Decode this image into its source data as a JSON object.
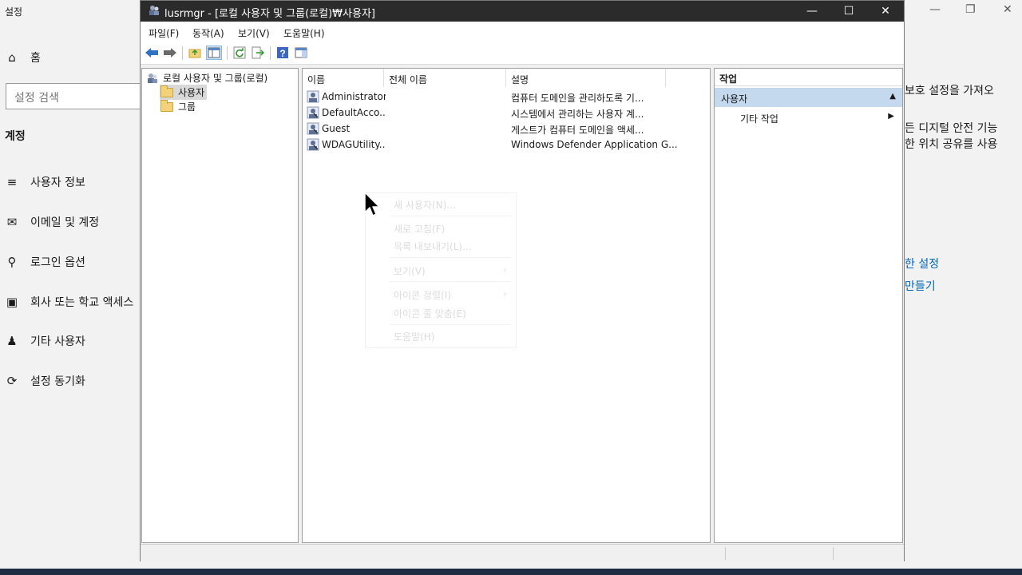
{
  "settings": {
    "app_title": "설정",
    "home": "홈",
    "search_placeholder": "설정 검색",
    "section": "계정",
    "nav": [
      "사용자 정보",
      "이메일 및 계정",
      "로그인 옵션",
      "회사 또는 학교 액세스",
      "기타 사용자",
      "설정 동기화"
    ],
    "right_texts": [
      "보호 설정을 가져오",
      "든 디지털 안전 기능",
      "한 위치 공유를 사용"
    ],
    "right_links": [
      "한 설정",
      "만들기"
    ]
  },
  "window": {
    "title": "lusrmgr - [로컬 사용자 및 그룹(로컬)₩사용자]",
    "menu": [
      "파일(F)",
      "동작(A)",
      "보기(V)",
      "도움말(H)"
    ]
  },
  "tree": {
    "root": "로컬 사용자 및 그룹(로컬)",
    "children": [
      "사용자",
      "그룹"
    ]
  },
  "list": {
    "columns": [
      "이름",
      "전체 이름",
      "설명"
    ],
    "rows": [
      {
        "name": "Administrator",
        "full_name": "",
        "description": "컴퓨터 도메인을 관리하도록 기..."
      },
      {
        "name": "DefaultAcco...",
        "full_name": "",
        "description": "시스템에서 관리하는 사용자 계..."
      },
      {
        "name": "Guest",
        "full_name": "",
        "description": "게스트가 컴퓨터 도메인을 액세..."
      },
      {
        "name": "WDAGUtility...",
        "full_name": "",
        "description": "Windows Defender Application G..."
      }
    ]
  },
  "actions": {
    "header": "작업",
    "section": "사용자",
    "more": "기타 작업"
  },
  "context_menu": {
    "items": [
      "새 사용자(N)...",
      "새로 고침(F)",
      "목록 내보내기(L)...",
      "보기(V)",
      "아이콘 정렬(I)",
      "아이콘 줄 맞춤(E)",
      "도움말(H)"
    ]
  },
  "colors": {
    "titlebar": "#2b2b2b",
    "selection": "#c4d8ee",
    "link": "#0066b4"
  }
}
